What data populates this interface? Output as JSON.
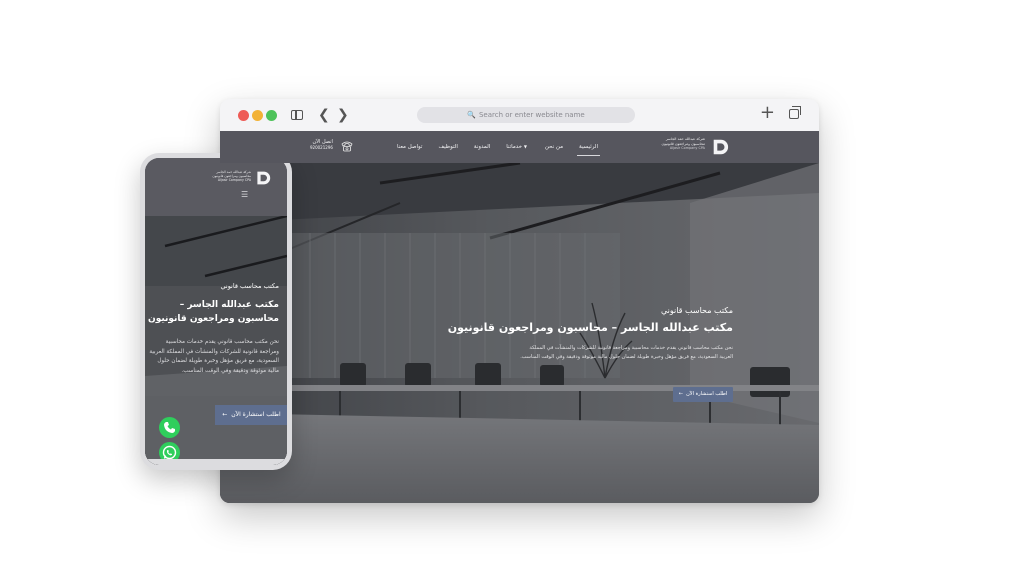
{
  "browser": {
    "url_placeholder": "Search or enter website name",
    "icons": [
      "sidebar-icon",
      "back-icon",
      "forward-icon",
      "search-icon",
      "plus-icon",
      "tabs-icon"
    ]
  },
  "site": {
    "logo": {
      "ar_line1": "شركة عبدالله حمد الجاسر",
      "ar_line2": "محاسبون ومراجعون قانونيون",
      "en_line": "Aljasir Company CPA"
    },
    "nav": [
      {
        "label": "الرئيسية",
        "active": true
      },
      {
        "label": "من نحن",
        "active": false
      },
      {
        "label": "خدماتنا",
        "active": false,
        "dropdown": true
      },
      {
        "label": "المدونة",
        "active": false
      },
      {
        "label": "التوظيف",
        "active": false
      },
      {
        "label": "تواصل معنا",
        "active": false
      }
    ],
    "call": {
      "label": "اتصل الآن",
      "number": "920021296"
    },
    "hero": {
      "eyebrow": "مكتب محاسب قانوني",
      "title": "مكتب عبدالله الجاسر – محاسبون ومراجعون قانونيون",
      "paragraph": "نحن مكتب محاسب قانوني يقدم خدمات محاسبية ومراجعة قانونية للشركات والمنشآت في المملكة العربية السعودية، مع فريق مؤهل وخبرة طويلة لضمان حلول مالية موثوقة ودقيقة وفي الوقت المناسب.",
      "cta": "اطلب استشارة الآن"
    }
  },
  "mobile": {
    "hero": {
      "eyebrow": "مكتب محاسب قانوني",
      "title": "مكتب عبدالله الجاسر – محاسبون ومراجعون قانونيون",
      "paragraph": "نحن مكتب محاسب قانوني يقدم خدمات محاسبية ومراجعة قانونية للشركات والمنشآت في المملكة العربية السعودية، مع فريق مؤهل وخبرة طويلة لضمان حلول مالية موثوقة ودقيقة وفي الوقت المناسب.",
      "cta": "اطلب استشارة الآن"
    }
  },
  "colors": {
    "header": "#56565e",
    "cta": "#5e6e8f",
    "whatsapp": "#2fce5c"
  }
}
